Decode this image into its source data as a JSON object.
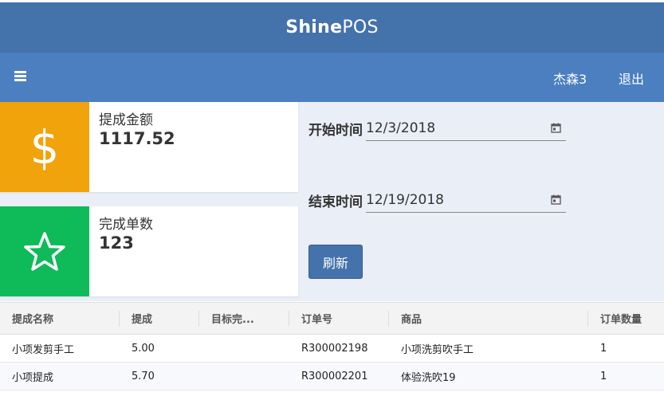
{
  "header": {
    "brand_bold": "Shine",
    "brand_light": "POS"
  },
  "toolbar": {
    "menu_icon": "hamburger-menu-icon",
    "user_name": "杰森3",
    "logout_label": "退出"
  },
  "stats": [
    {
      "label": "提成金额",
      "value": "1117.52",
      "icon": "dollar-icon",
      "color": "#f0a30a"
    },
    {
      "label": "完成单数",
      "value": "123",
      "icon": "star-icon",
      "color": "#0fba58"
    }
  ],
  "filters": {
    "start_label": "开始时间",
    "start_value": "12/3/2018",
    "end_label": "结束时间",
    "end_value": "12/19/2018",
    "refresh_label": "刷新"
  },
  "table": {
    "columns": [
      "提成名称",
      "提成",
      "目标完...",
      "订单号",
      "商品",
      "订单数量"
    ],
    "rows": [
      [
        "小项发剪手工",
        "5.00",
        "",
        "R300002198",
        "小项洗剪吹手工",
        "1"
      ],
      [
        "小项提成",
        "5.70",
        "",
        "R300002201",
        "体验洗吹19",
        "1"
      ]
    ]
  },
  "colors": {
    "header": "#4472ab",
    "toolbar": "#4b7fc0",
    "accent_orange": "#f0a30a",
    "accent_green": "#0fba58"
  }
}
